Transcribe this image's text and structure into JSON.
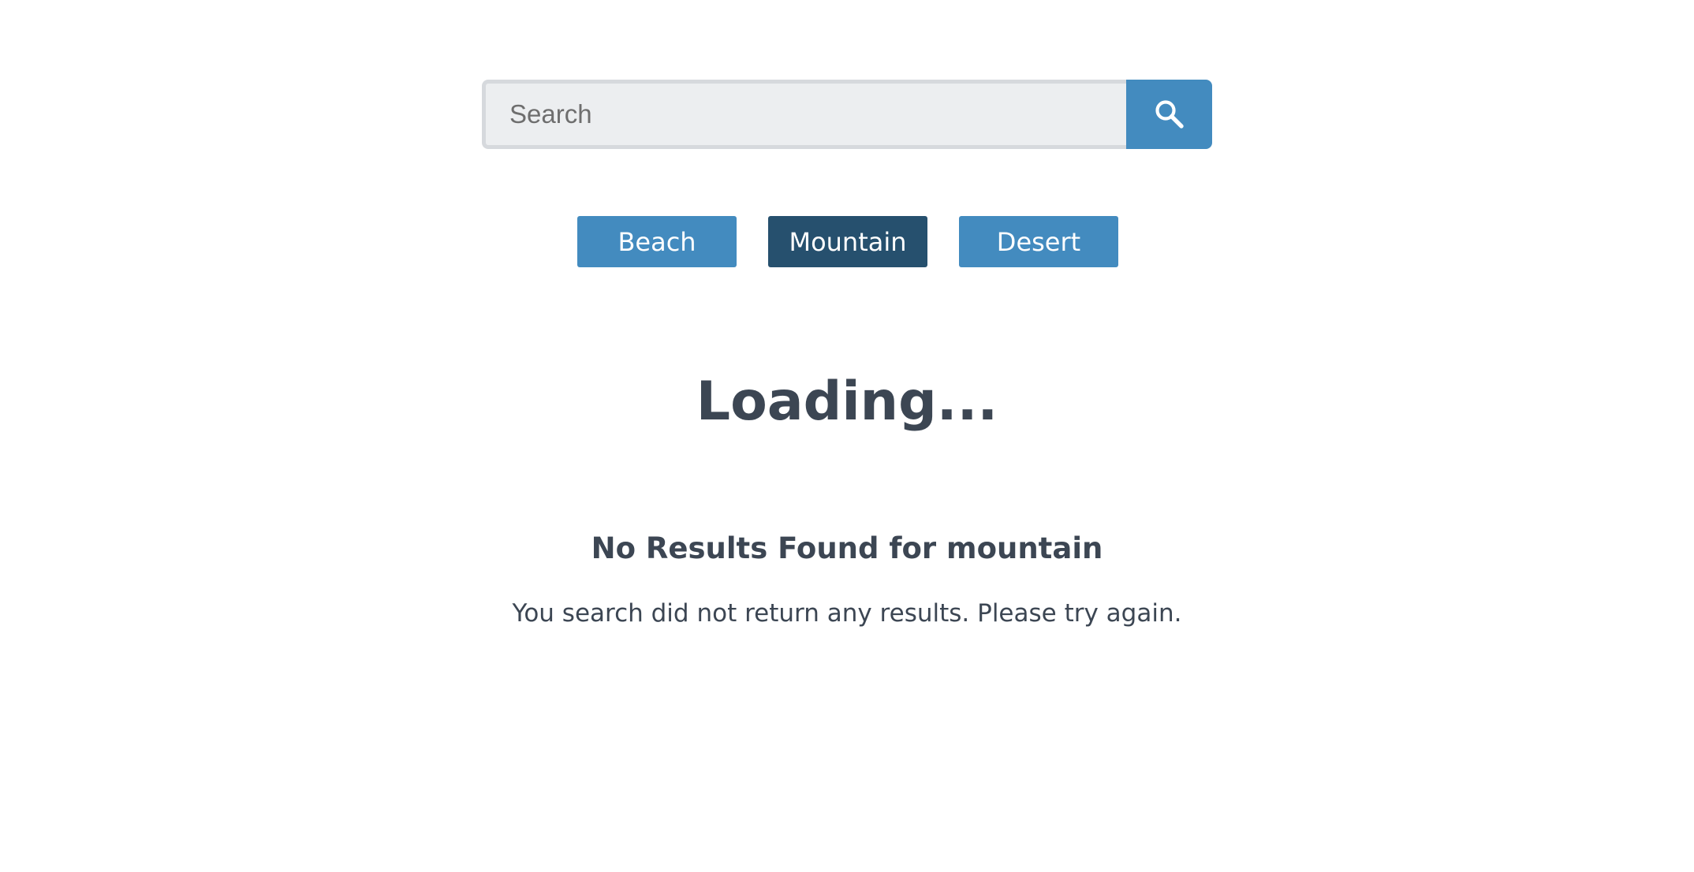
{
  "search": {
    "placeholder": "Search",
    "value": "",
    "button_icon": "search-icon"
  },
  "filters": [
    {
      "label": "Beach",
      "active": false
    },
    {
      "label": "Mountain",
      "active": true
    },
    {
      "label": "Desert",
      "active": false
    }
  ],
  "status": {
    "loading_text": "Loading..."
  },
  "results": {
    "title": "No Results Found for mountain",
    "message": "You search did not return any results. Please try again."
  },
  "colors": {
    "primary": "#438bbf",
    "active": "#26506e",
    "text": "#3c4653",
    "input_bg": "#eceef0",
    "input_border": "#d6d9dd"
  }
}
